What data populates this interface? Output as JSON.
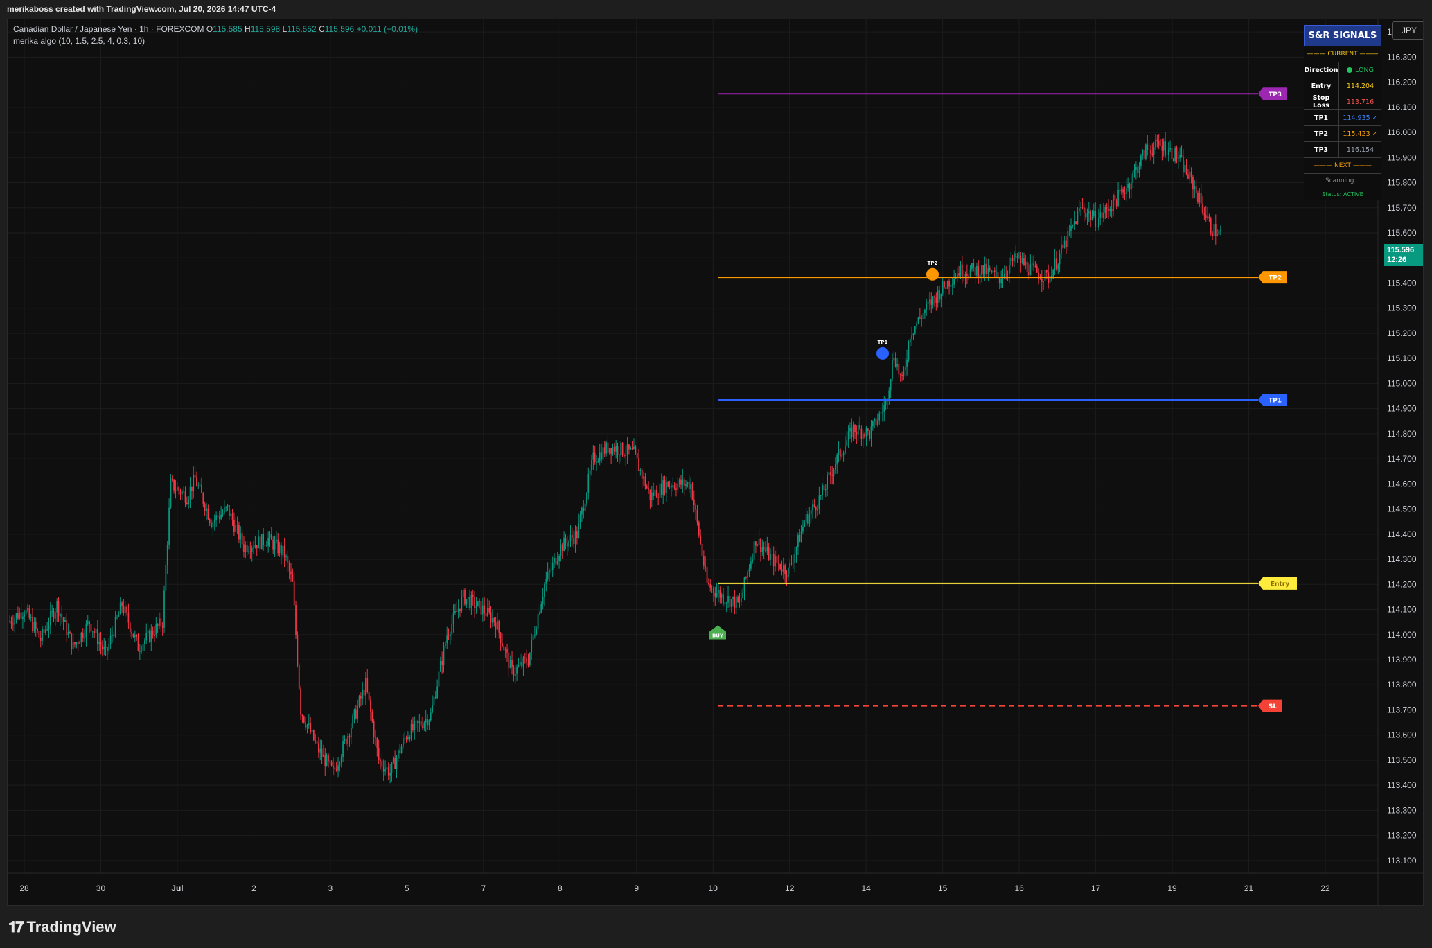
{
  "header": {
    "created_by": "merikaboss created with TradingView.com, Jul 20, 2026 14:47 UTC-4"
  },
  "legend": {
    "symbol": "Canadian Dollar / Japanese Yen · 1h · FOREXCOM",
    "o_label": "O",
    "o_value": "115.585",
    "h_label": "H",
    "h_value": "115.598",
    "l_label": "L",
    "l_value": "115.552",
    "c_label": "C",
    "c_value": "115.596",
    "change": "+0.011 (+0.01%)",
    "indicator": "merika algo (10, 1.5, 2.5, 4, 0.3, 10)"
  },
  "currency_button": "JPY",
  "last_price": {
    "price": "115.596",
    "countdown": "12:26"
  },
  "footer": {
    "brand": "TradingView"
  },
  "signals_table": {
    "title": "S&R SIGNALS",
    "current_header": "——— CURRENT ———",
    "rows": [
      {
        "label": "Direction",
        "value": "LONG",
        "color": "#22c55e"
      },
      {
        "label": "Entry",
        "value": "114.204",
        "color": "#facc15"
      },
      {
        "label": "Stop Loss",
        "value": "113.716",
        "color": "#ef5350"
      },
      {
        "label": "TP1",
        "value": "114.935 ✓",
        "color": "#3b82f6"
      },
      {
        "label": "TP2",
        "value": "115.423 ✓",
        "color": "#f59e0b"
      },
      {
        "label": "TP3",
        "value": "116.154",
        "color": "#9ca3af"
      }
    ],
    "next_header": "——— NEXT ———",
    "scanning": "Scanning...",
    "status": "Status: ACTIVE"
  },
  "chart_data": {
    "type": "candlestick",
    "y_axis": {
      "ylim": [
        113.05,
        116.45
      ],
      "ticks": [
        "116.400",
        "116.300",
        "116.200",
        "116.100",
        "116.000",
        "115.900",
        "115.800",
        "115.700",
        "115.600",
        "115.500",
        "115.400",
        "115.300",
        "115.200",
        "115.100",
        "115.000",
        "114.900",
        "114.800",
        "114.700",
        "114.600",
        "114.500",
        "114.400",
        "114.300",
        "114.200",
        "114.100",
        "114.000",
        "113.900",
        "113.800",
        "113.700",
        "113.600",
        "113.500",
        "113.400",
        "113.300",
        "113.200",
        "113.100"
      ]
    },
    "x_axis": {
      "ticks": [
        "28",
        "30",
        "Jul",
        "2",
        "3",
        "5",
        "7",
        "8",
        "9",
        "10",
        "12",
        "14",
        "15",
        "16",
        "17",
        "19",
        "21",
        "22"
      ]
    },
    "levels": [
      {
        "name": "TP3",
        "price": 116.154,
        "color": "#9c27b0",
        "style": "solid"
      },
      {
        "name": "TP2",
        "price": 115.423,
        "color": "#ff9800",
        "style": "solid"
      },
      {
        "name": "TP1",
        "price": 114.935,
        "color": "#2962ff",
        "style": "solid"
      },
      {
        "name": "Entry",
        "price": 114.204,
        "color": "#ffeb3b",
        "style": "solid"
      },
      {
        "name": "SL",
        "price": 113.716,
        "color": "#f44336",
        "style": "dashed"
      }
    ],
    "markers": [
      {
        "name": "BUY",
        "price": 114.02,
        "color": "#4caf50"
      },
      {
        "name": "TP1",
        "price": 115.12,
        "color": "#2962ff"
      },
      {
        "name": "TP2",
        "price": 115.435,
        "color": "#ff9800"
      }
    ],
    "up_color": "#089981",
    "down_color": "#f23645",
    "path_points": [
      [
        114.05,
        0
      ],
      [
        114.1,
        10
      ],
      [
        113.98,
        20
      ],
      [
        114.12,
        30
      ],
      [
        113.95,
        40
      ],
      [
        114.05,
        50
      ],
      [
        113.92,
        60
      ],
      [
        114.12,
        70
      ],
      [
        113.95,
        80
      ],
      [
        114.05,
        95
      ],
      [
        114.6,
        100
      ],
      [
        114.55,
        110
      ],
      [
        114.62,
        115
      ],
      [
        114.45,
        125
      ],
      [
        114.5,
        135
      ],
      [
        114.35,
        145
      ],
      [
        114.38,
        160
      ],
      [
        114.32,
        170
      ],
      [
        114.2,
        175
      ],
      [
        113.7,
        180
      ],
      [
        113.55,
        190
      ],
      [
        113.45,
        200
      ],
      [
        113.62,
        210
      ],
      [
        113.8,
        220
      ],
      [
        113.5,
        228
      ],
      [
        113.45,
        235
      ],
      [
        113.6,
        245
      ],
      [
        113.68,
        260
      ],
      [
        114.0,
        270
      ],
      [
        114.15,
        280
      ],
      [
        114.1,
        292
      ],
      [
        114.05,
        300
      ],
      [
        113.85,
        310
      ],
      [
        113.9,
        320
      ],
      [
        114.2,
        330
      ],
      [
        114.35,
        340
      ],
      [
        114.4,
        350
      ],
      [
        114.7,
        360
      ],
      [
        114.75,
        370
      ],
      [
        114.72,
        385
      ],
      [
        114.55,
        395
      ],
      [
        114.6,
        405
      ],
      [
        114.6,
        420
      ],
      [
        114.2,
        430
      ],
      [
        114.15,
        440
      ],
      [
        114.12,
        450
      ],
      [
        114.38,
        460
      ],
      [
        114.3,
        470
      ],
      [
        114.25,
        480
      ],
      [
        114.45,
        490
      ],
      [
        114.55,
        500
      ],
      [
        114.7,
        510
      ],
      [
        114.82,
        520
      ],
      [
        114.8,
        530
      ],
      [
        114.92,
        540
      ],
      [
        115.12,
        545
      ],
      [
        115.0,
        550
      ],
      [
        115.2,
        555
      ],
      [
        115.3,
        565
      ],
      [
        115.38,
        575
      ],
      [
        115.45,
        585
      ],
      [
        115.45,
        600
      ],
      [
        115.42,
        610
      ],
      [
        115.5,
        620
      ],
      [
        115.45,
        630
      ],
      [
        115.42,
        640
      ],
      [
        115.55,
        650
      ],
      [
        115.7,
        660
      ],
      [
        115.65,
        670
      ],
      [
        115.72,
        680
      ],
      [
        115.8,
        690
      ],
      [
        115.93,
        700
      ],
      [
        115.95,
        710
      ],
      [
        115.9,
        720
      ],
      [
        115.78,
        730
      ],
      [
        115.62,
        740
      ],
      [
        115.6,
        745
      ]
    ]
  }
}
